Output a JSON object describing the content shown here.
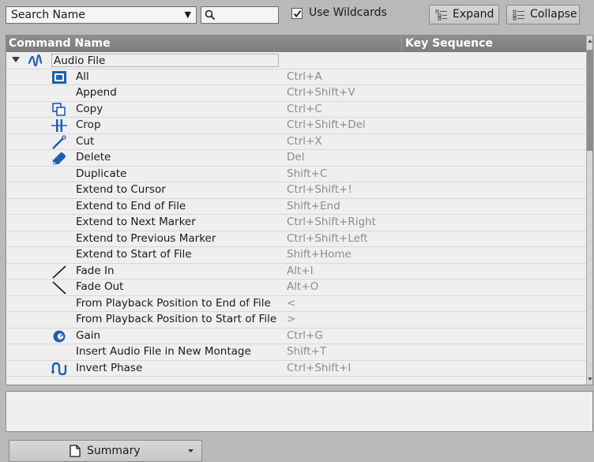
{
  "toolbar": {
    "search_mode": "Search Name",
    "search_value": "",
    "wildcards_label": "Use Wildcards",
    "wildcards_checked": true,
    "expand_label": "Expand",
    "collapse_label": "Collapse"
  },
  "table": {
    "columns": [
      "Command Name",
      "Key Sequence"
    ],
    "group": {
      "name": "Audio File",
      "icon": "waveform-icon",
      "expanded": true
    },
    "rows": [
      {
        "name": "All",
        "key": "Ctrl+A",
        "icon": "select-all-icon"
      },
      {
        "name": "Append",
        "key": "Ctrl+Shift+V",
        "icon": ""
      },
      {
        "name": "Copy",
        "key": "Ctrl+C",
        "icon": "copy-icon"
      },
      {
        "name": "Crop",
        "key": "Ctrl+Shift+Del",
        "icon": "crop-icon"
      },
      {
        "name": "Cut",
        "key": "Ctrl+X",
        "icon": "cut-icon"
      },
      {
        "name": "Delete",
        "key": "Del",
        "icon": "eraser-icon"
      },
      {
        "name": "Duplicate",
        "key": "Shift+C",
        "icon": ""
      },
      {
        "name": "Extend to Cursor",
        "key": "Ctrl+Shift+!",
        "icon": ""
      },
      {
        "name": "Extend to End of File",
        "key": "Shift+End",
        "icon": ""
      },
      {
        "name": "Extend to Next Marker",
        "key": "Ctrl+Shift+Right",
        "icon": ""
      },
      {
        "name": "Extend to Previous Marker",
        "key": "Ctrl+Shift+Left",
        "icon": ""
      },
      {
        "name": "Extend to Start of File",
        "key": "Shift+Home",
        "icon": ""
      },
      {
        "name": "Fade In",
        "key": "Alt+I",
        "icon": "fade-in-icon"
      },
      {
        "name": "Fade Out",
        "key": "Alt+O",
        "icon": "fade-out-icon"
      },
      {
        "name": "From Playback Position to End of File",
        "key": "<",
        "icon": ""
      },
      {
        "name": "From Playback Position to Start of File",
        "key": ">",
        "icon": ""
      },
      {
        "name": "Gain",
        "key": "Ctrl+G",
        "icon": "gain-icon"
      },
      {
        "name": "Insert Audio File in New Montage",
        "key": "Shift+T",
        "icon": ""
      },
      {
        "name": "Invert Phase",
        "key": "Ctrl+Shift+I",
        "icon": "invert-phase-icon"
      }
    ]
  },
  "description": "",
  "bottom": {
    "summary_label": "Summary"
  },
  "colors": {
    "accent": "#1f5fae",
    "header_bg": "#868686",
    "panel_bg": "#b9b9b9"
  }
}
